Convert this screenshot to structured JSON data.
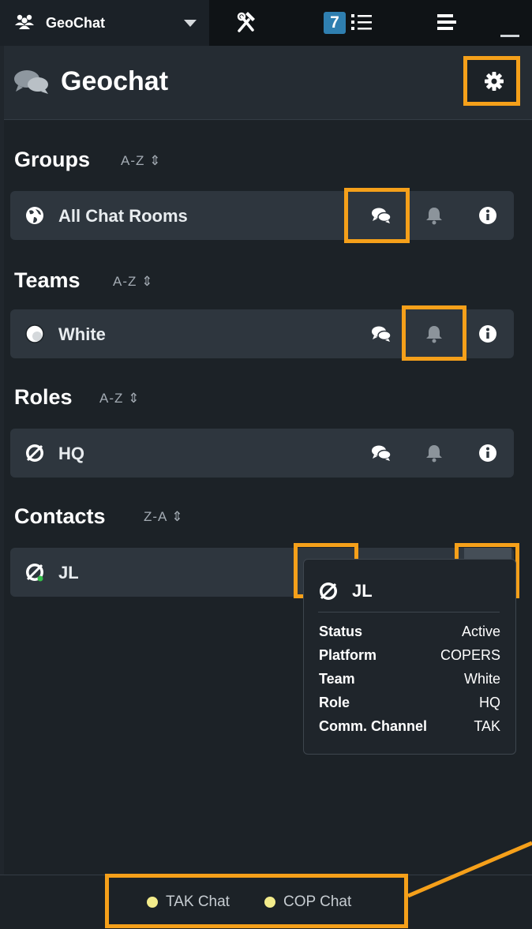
{
  "topbar": {
    "app_name": "GeoChat",
    "badge_count": "7"
  },
  "header": {
    "title": "Geochat"
  },
  "sections": {
    "groups": {
      "title": "Groups",
      "sort": "A-Z",
      "row_label": "All Chat Rooms"
    },
    "teams": {
      "title": "Teams",
      "sort": "A-Z",
      "row_label": "White"
    },
    "roles": {
      "title": "Roles",
      "sort": "A-Z",
      "row_label": "HQ"
    },
    "contacts": {
      "title": "Contacts",
      "sort": "Z-A",
      "row_label": "JL"
    }
  },
  "tooltip": {
    "name": "JL",
    "rows": [
      {
        "key": "Status",
        "value": "Active"
      },
      {
        "key": "Platform",
        "value": "COPERS"
      },
      {
        "key": "Team",
        "value": "White"
      },
      {
        "key": "Role",
        "value": "HQ"
      },
      {
        "key": "Comm. Channel",
        "value": "TAK"
      }
    ]
  },
  "footer": {
    "items": [
      "TAK Chat",
      "COP Chat"
    ],
    "dot_color": "#f3ec8b"
  },
  "colors": {
    "highlight": "#f5a01a",
    "accent": "#2f7fb0"
  }
}
